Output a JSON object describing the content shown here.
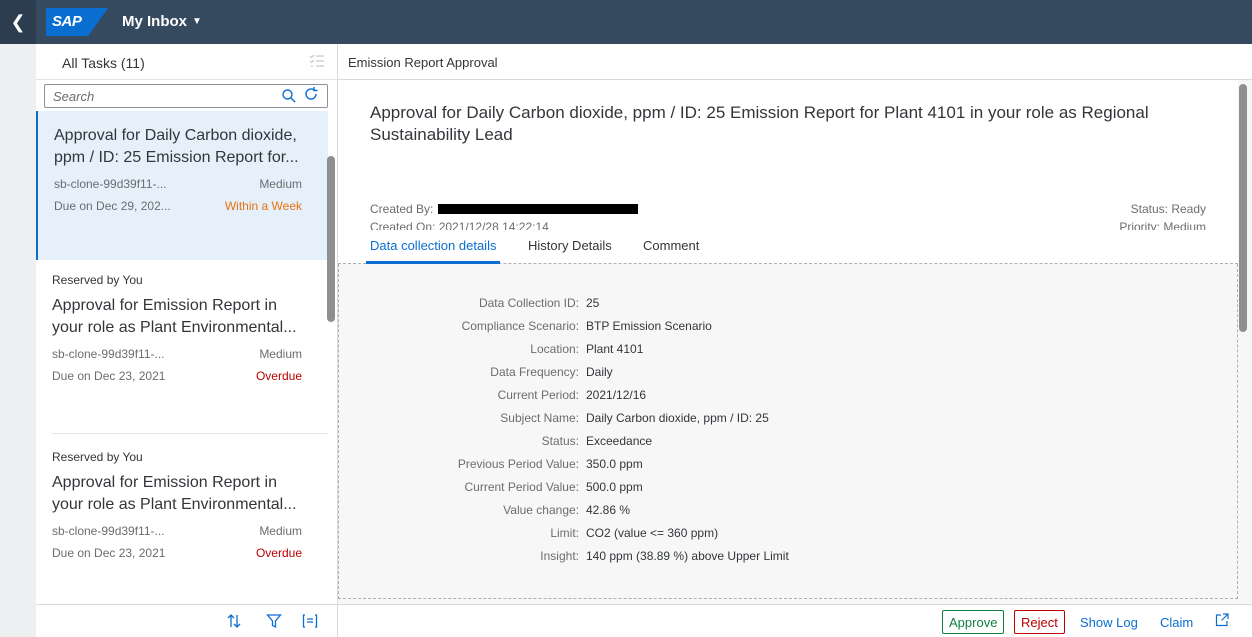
{
  "shell": {
    "back_icon": "chevron-left-icon",
    "logo": "SAP",
    "title": "My Inbox",
    "caret": "▼"
  },
  "master": {
    "header": "All Tasks (11)",
    "search_placeholder": "Search",
    "tasks": [
      {
        "reserved": "",
        "title": "Approval for Daily Carbon dioxide, ppm / ID: 25 Emission Report for...",
        "id": "sb-clone-99d39f11-...",
        "priority": "Medium",
        "due": "Due on Dec 29, 202...",
        "status": "Within a Week"
      },
      {
        "reserved": "Reserved by You",
        "title": "Approval for Emission Report in your role as Plant Environmental...",
        "id": "sb-clone-99d39f11-...",
        "priority": "Medium",
        "due": "Due on Dec 23, 2021",
        "status": "Overdue"
      },
      {
        "reserved": "Reserved by You",
        "title": "Approval for Emission Report in your role as Plant Environmental...",
        "id": "sb-clone-99d39f11-...",
        "priority": "Medium",
        "due": "Due on Dec 23, 2021",
        "status": "Overdue"
      }
    ],
    "footer_icons": [
      "sort-icon",
      "filter-icon",
      "group-icon"
    ]
  },
  "detail": {
    "header": "Emission Report Approval",
    "title": "Approval for Daily Carbon dioxide, ppm / ID: 25 Emission Report for Plant 4101 in your role as Regional Sustainability Lead",
    "created_by_label": "Created By:",
    "created_on": "Created On: 2021/12/28 14:22:14",
    "status": "Status: Ready",
    "priority": "Priority: Medium",
    "tabs": [
      "Data collection details",
      "History Details",
      "Comment"
    ],
    "fields": [
      {
        "label": "Data Collection ID:",
        "value": "25"
      },
      {
        "label": "Compliance Scenario:",
        "value": "BTP Emission Scenario"
      },
      {
        "label": "Location:",
        "value": "Plant 4101"
      },
      {
        "label": "Data Frequency:",
        "value": "Daily"
      },
      {
        "label": "Current Period:",
        "value": "2021/12/16"
      },
      {
        "label": "Subject Name:",
        "value": "Daily Carbon dioxide, ppm / ID: 25"
      },
      {
        "label": "Status:",
        "value": "Exceedance"
      },
      {
        "label": "Previous Period Value:",
        "value": "350.0 ppm"
      },
      {
        "label": "Current Period Value:",
        "value": "500.0 ppm"
      },
      {
        "label": "Value change:",
        "value": "42.86 %"
      },
      {
        "label": "Limit:",
        "value": "CO2 (value <= 360 ppm)"
      },
      {
        "label": "Insight:",
        "value": "140 ppm (38.89 %) above Upper Limit"
      }
    ],
    "footer": {
      "approve": "Approve",
      "reject": "Reject",
      "show_log": "Show Log",
      "claim": "Claim"
    }
  },
  "colors": {
    "shell": "#354a5f",
    "accent": "#0a6ed1",
    "positive": "#107e3e",
    "negative": "#bb0000",
    "warning": "#e9730c"
  }
}
